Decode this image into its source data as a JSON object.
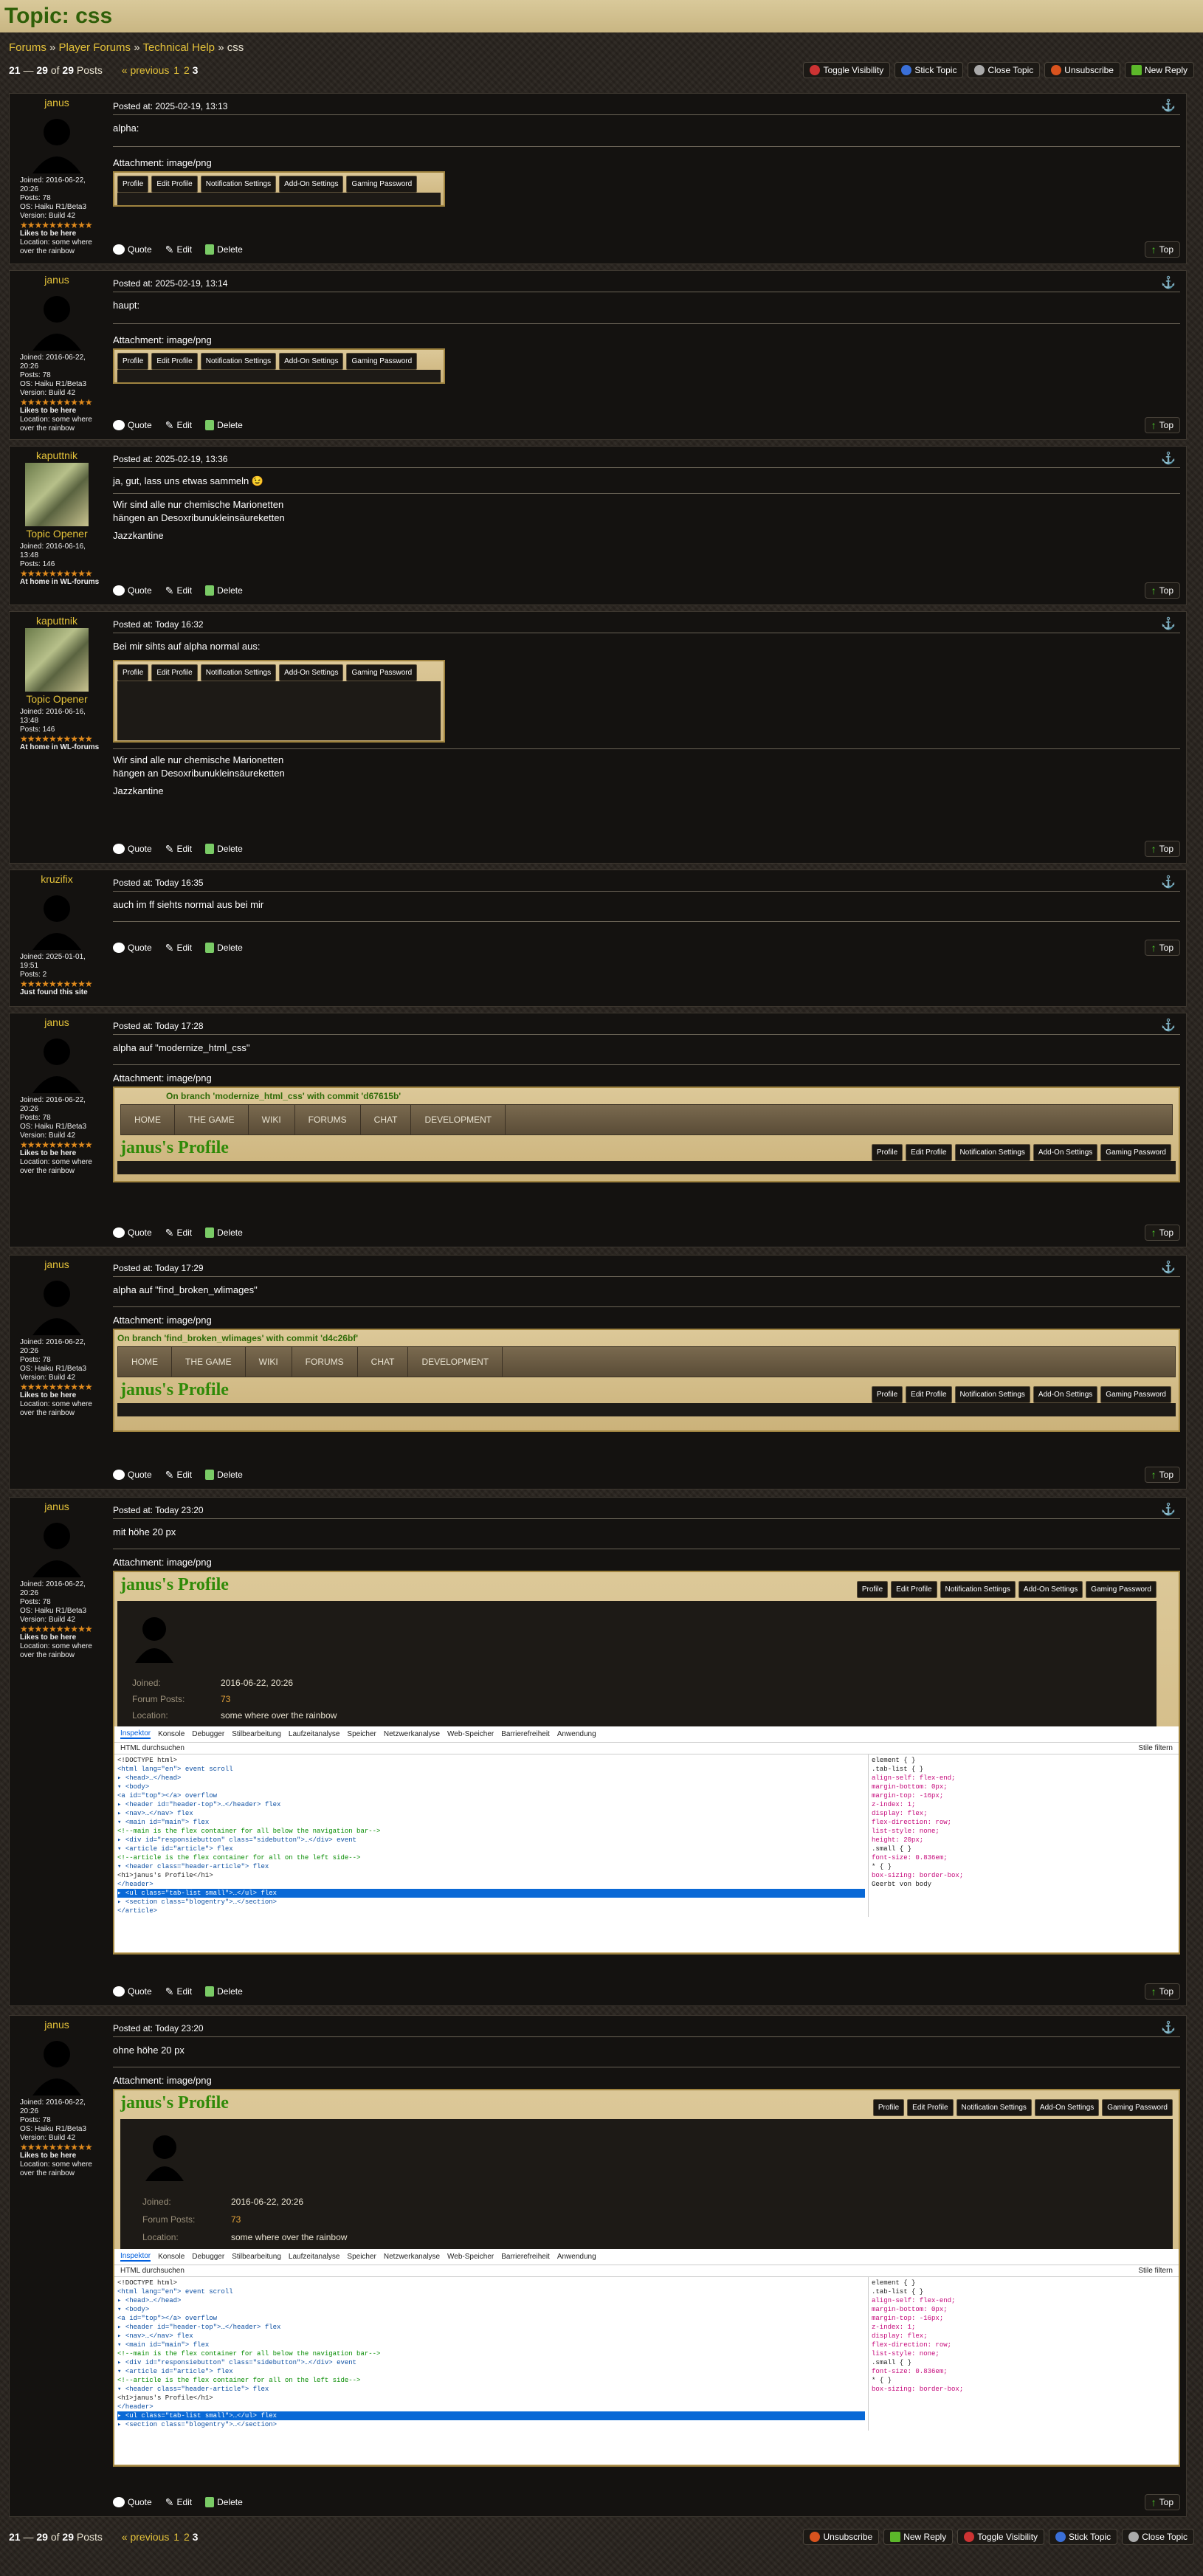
{
  "title": "Topic: css",
  "breadcrumb": [
    "Forums",
    "Player Forums",
    "Technical Help",
    "css"
  ],
  "posts_count": {
    "from": "21",
    "to": "29",
    "total": "29",
    "label": "Posts"
  },
  "pager": {
    "prev": "« previous",
    "pages": [
      "1",
      "2"
    ],
    "current": "3"
  },
  "top_buttons": [
    "Toggle Visibility",
    "Stick Topic",
    "Close Topic",
    "Unsubscribe",
    "New Reply"
  ],
  "bottom_buttons": [
    "Unsubscribe",
    "New Reply",
    "Toggle Visibility",
    "Stick Topic",
    "Close Topic"
  ],
  "actions": {
    "quote": "Quote",
    "edit": "Edit",
    "delete": "Delete",
    "top": "Top"
  },
  "profile_tabs": [
    "Profile",
    "Edit Profile",
    "Notification Settings",
    "Add-On Settings",
    "Gaming Password"
  ],
  "site_nav": [
    "HOME",
    "THE GAME",
    "WIKI",
    "FORUMS",
    "CHAT",
    "DEVELOPMENT"
  ],
  "attachment_label": "Attachment: image/png",
  "users": {
    "janus": {
      "name": "janus",
      "joined": "Joined: 2016-06-22, 20:26",
      "posts": "Posts: 78",
      "os": "OS: Haiku R1/Beta3",
      "version": "Version: Build 42",
      "rank": "Likes to be here",
      "location": "Location: some where over the rainbow"
    },
    "kaputtnik": {
      "name": "kaputtnik",
      "opener": "Topic Opener",
      "joined": "Joined: 2016-06-16, 13:48",
      "posts": "Posts: 146",
      "rank": "At home in WL-forums"
    },
    "kruzifix": {
      "name": "kruzifix",
      "joined": "Joined: 2025-01-01, 19:51",
      "posts": "Posts: 2",
      "rank": "Just found this site"
    }
  },
  "posts": [
    {
      "time": "Posted at: 2025-02-19, 13:13",
      "text": "alpha:"
    },
    {
      "time": "Posted at: 2025-02-19, 13:14",
      "text": "haupt:"
    },
    {
      "time": "Posted at: 2025-02-19, 13:36",
      "text": "ja, gut, lass uns etwas sammeln 😉",
      "text2": "Wir sind alle nur chemische Marionetten",
      "text3": "hängen an Desoxribunukleinsäureketten",
      "text4": "Jazzkantine"
    },
    {
      "time": "Posted at: Today 16:32",
      "text": "Bei mir sihts auf alpha normal aus:",
      "text2": "Wir sind alle nur chemische Marionetten",
      "text3": "hängen an Desoxribunukleinsäureketten",
      "text4": "Jazzkantine"
    },
    {
      "time": "Posted at: Today 16:35",
      "text": "auch im ff siehts normal aus bei mir"
    },
    {
      "time": "Posted at: Today 17:28",
      "text": "alpha auf \"modernize_html_css\"",
      "note": "On branch 'modernize_html_css' with commit 'd67615b'",
      "profile": "janus's Profile"
    },
    {
      "time": "Posted at: Today 17:29",
      "text": "alpha auf \"find_broken_wlimages\"",
      "note": "On branch 'find_broken_wlimages' with commit 'd4c26bf'",
      "profile": "janus's Profile"
    },
    {
      "time": "Posted at: Today 23:20",
      "text": "mit höhe 20 px",
      "profile": "janus's Profile",
      "joined_label": "Joined:",
      "joined_val": "2016-06-22, 20:26",
      "fp_label": "Forum Posts:",
      "fp_val": "73",
      "loc_label": "Location:",
      "loc_val": "some where over the rainbow"
    },
    {
      "time": "Posted at: Today 23:20",
      "text": "ohne höhe 20 px",
      "profile": "janus's Profile",
      "joined_label": "Joined:",
      "joined_val": "2016-06-22, 20:26",
      "fp_label": "Forum Posts:",
      "fp_val": "73",
      "loc_label": "Location:",
      "loc_val": "some where over the rainbow"
    }
  ],
  "devtools": {
    "tabs": [
      "Inspektor",
      "Konsole",
      "Debugger",
      "Stilbearbeitung",
      "Laufzeitanalyse",
      "Speicher",
      "Netzwerkanalyse",
      "Web-Speicher",
      "Barrierefreiheit",
      "Anwendung"
    ],
    "search": "HTML durchsuchen",
    "filter": "Stile filtern",
    "html_lines": [
      "<!DOCTYPE html>",
      "<html lang=\"en\"> event scroll",
      " ▸ <head>…</head>",
      " ▾ <body>",
      "    <a id=\"top\"></a> overflow",
      "  ▸ <header id=\"header-top\">…</header> flex",
      "  ▸ <nav>…</nav> flex",
      "  ▾ <main id=\"main\"> flex",
      "      <!--main is the flex container for all below the navigation bar-->",
      "    ▸ <div id=\"responsiebutton\" class=\"sidebutton\">…</div> event",
      "    ▾ <article id=\"article\"> flex",
      "        <!--article is the flex container for all on the left side-->",
      "      ▾ <header class=\"header-article\"> flex",
      "          <h1>janus's Profile</h1>",
      "        </header>",
      "      ▸ <ul class=\"tab-list small\">…</ul> flex",
      "      ▸ <section class=\"blogentry\">…</section>",
      "      </article>"
    ],
    "css_lines": [
      "element { }",
      ".tab-list { }",
      "  align-self: flex-end;",
      "  margin-bottom: 0px;",
      "  margin-top: -16px;",
      "  z-index: 1;",
      "  display: flex;",
      "  flex-direction: row;",
      "  list-style: none;",
      "  height: 20px;",
      ".small { }",
      "  font-size: 0.836em;",
      "* { }",
      "  box-sizing: border-box;",
      "Geerbt von body"
    ]
  }
}
